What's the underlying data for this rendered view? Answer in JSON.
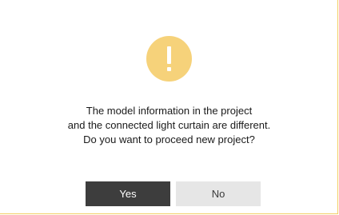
{
  "dialog": {
    "icon": "warning-exclamation-icon",
    "message_lines": [
      "The model information in the project",
      "and the connected light curtain are different.",
      "Do you want to proceed new project?"
    ],
    "buttons": {
      "yes_label": "Yes",
      "no_label": "No"
    }
  },
  "colors": {
    "icon_circle": "#f6d27a",
    "icon_mark": "#ffffff",
    "yes_button_bg": "#3d3d3d",
    "no_button_bg": "#e6e6e6",
    "border_accent": "#f3cf63"
  }
}
